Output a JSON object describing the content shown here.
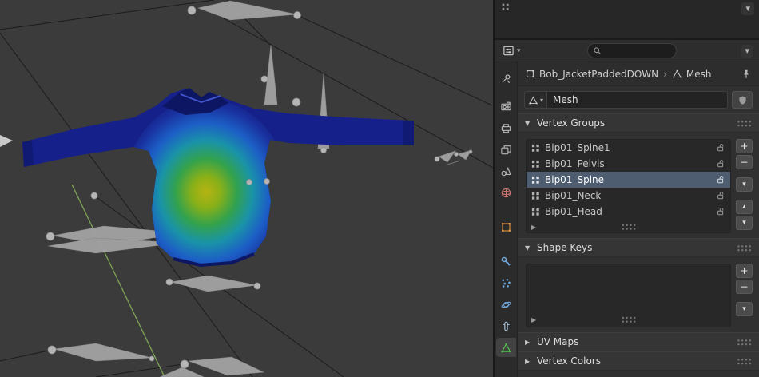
{
  "header": {
    "search_value": "",
    "chevron": "▾"
  },
  "breadcrumb": {
    "object_name": "Bob_JacketPaddedDOWN",
    "separator": "›",
    "data_name": "Mesh"
  },
  "datablock": {
    "name": "Mesh"
  },
  "tabs": [
    {
      "id": "tool",
      "color": "#b8b8b8",
      "active": false
    },
    {
      "id": "render",
      "color": "#b8b8b8",
      "active": false
    },
    {
      "id": "output",
      "color": "#b8b8b8",
      "active": false
    },
    {
      "id": "view-layer",
      "color": "#b8b8b8",
      "active": false
    },
    {
      "id": "scene",
      "color": "#b8b8b8",
      "active": false
    },
    {
      "id": "world",
      "color": "#c8756b",
      "active": false
    },
    {
      "id": "object",
      "color": "#e0923c",
      "active": false
    },
    {
      "id": "modifiers",
      "color": "#6fa8dc",
      "active": false
    },
    {
      "id": "particles",
      "color": "#6fa8dc",
      "active": false
    },
    {
      "id": "physics",
      "color": "#6fa8dc",
      "active": false
    },
    {
      "id": "constraints",
      "color": "#9fb6cc",
      "active": false
    },
    {
      "id": "object-data",
      "color": "#53c253",
      "active": true
    }
  ],
  "vertex_groups": {
    "title": "Vertex Groups",
    "items": [
      {
        "name": "Bip01_Spine1",
        "locked": false
      },
      {
        "name": "Bip01_Pelvis",
        "locked": false
      },
      {
        "name": "Bip01_Spine",
        "locked": false
      },
      {
        "name": "Bip01_Neck",
        "locked": false
      },
      {
        "name": "Bip01_Head",
        "locked": false
      }
    ],
    "selected": "Bip01_Spine"
  },
  "shape_keys": {
    "title": "Shape Keys",
    "items": []
  },
  "uv_maps": {
    "title": "UV Maps",
    "expanded": false
  },
  "vertex_colors": {
    "title": "Vertex Colors",
    "expanded": false
  },
  "glyphs": {
    "plus": "+",
    "minus": "−",
    "menu": "▾",
    "up": "▴",
    "down": "▾",
    "open": "▼",
    "closed": "▶",
    "chevron": "▾",
    "separator": "›"
  },
  "colors": {
    "selection": "#4e5d70",
    "panel_header": "#353535",
    "list_bg": "#282828",
    "viewport_bg": "#3b3b3b",
    "weight_paint": [
      "#141f85",
      "#1c5fc6",
      "#1a93a8",
      "#33a24c",
      "#8ab018",
      "#b6b312"
    ]
  }
}
